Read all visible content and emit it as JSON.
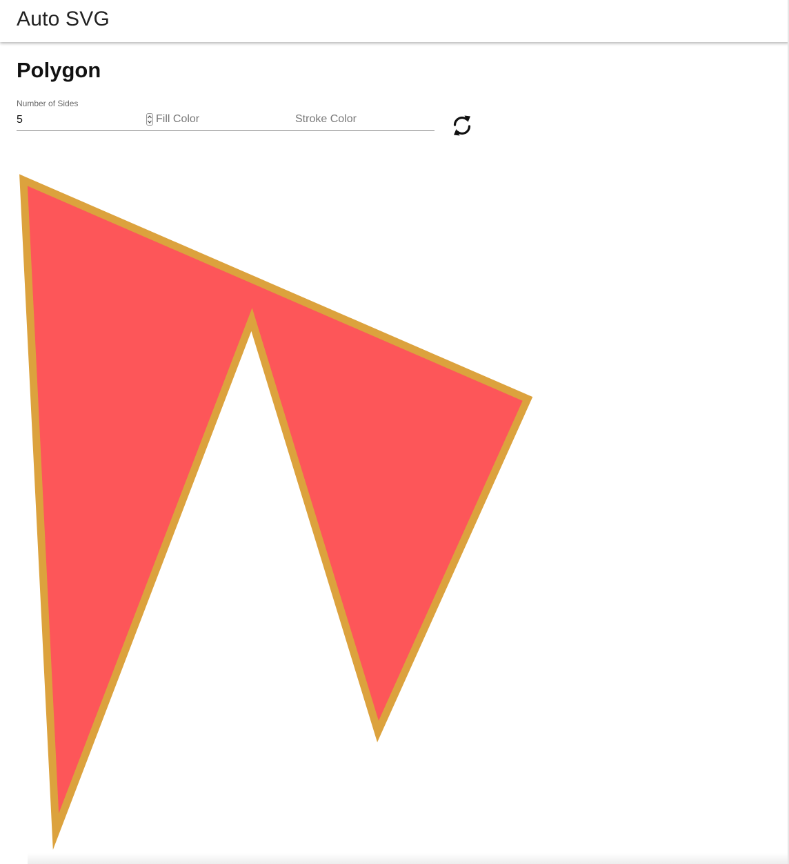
{
  "app": {
    "title": "Auto SVG"
  },
  "page": {
    "heading": "Polygon"
  },
  "form": {
    "sides_label": "Number of Sides",
    "sides_value": "5",
    "fill_color_placeholder": "Fill Color",
    "stroke_color_placeholder": "Stroke Color"
  },
  "icons": {
    "refresh": "refresh-icon",
    "spinner": "spinner-arrows-icon"
  },
  "polygon": {
    "sides": 5,
    "fill_color": "#fd5659",
    "stroke_color": "#dca23d"
  }
}
